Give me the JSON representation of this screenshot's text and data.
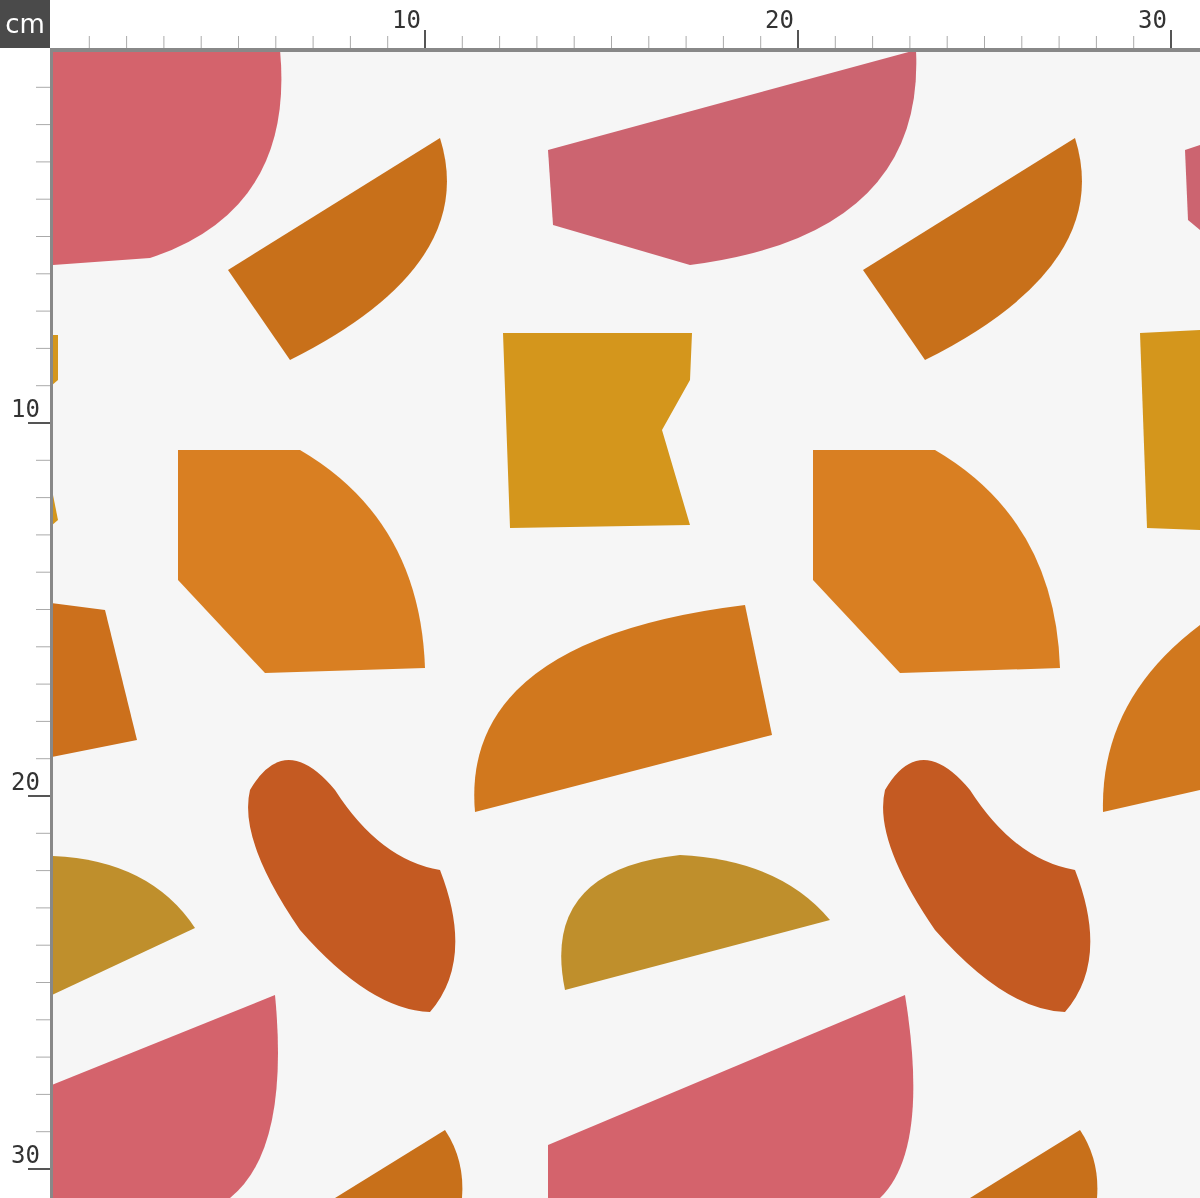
{
  "unit": "cm",
  "top_ruler": {
    "labels": [
      "10",
      "20",
      "30"
    ]
  },
  "left_ruler": {
    "labels": [
      "10",
      "20",
      "30"
    ]
  }
}
